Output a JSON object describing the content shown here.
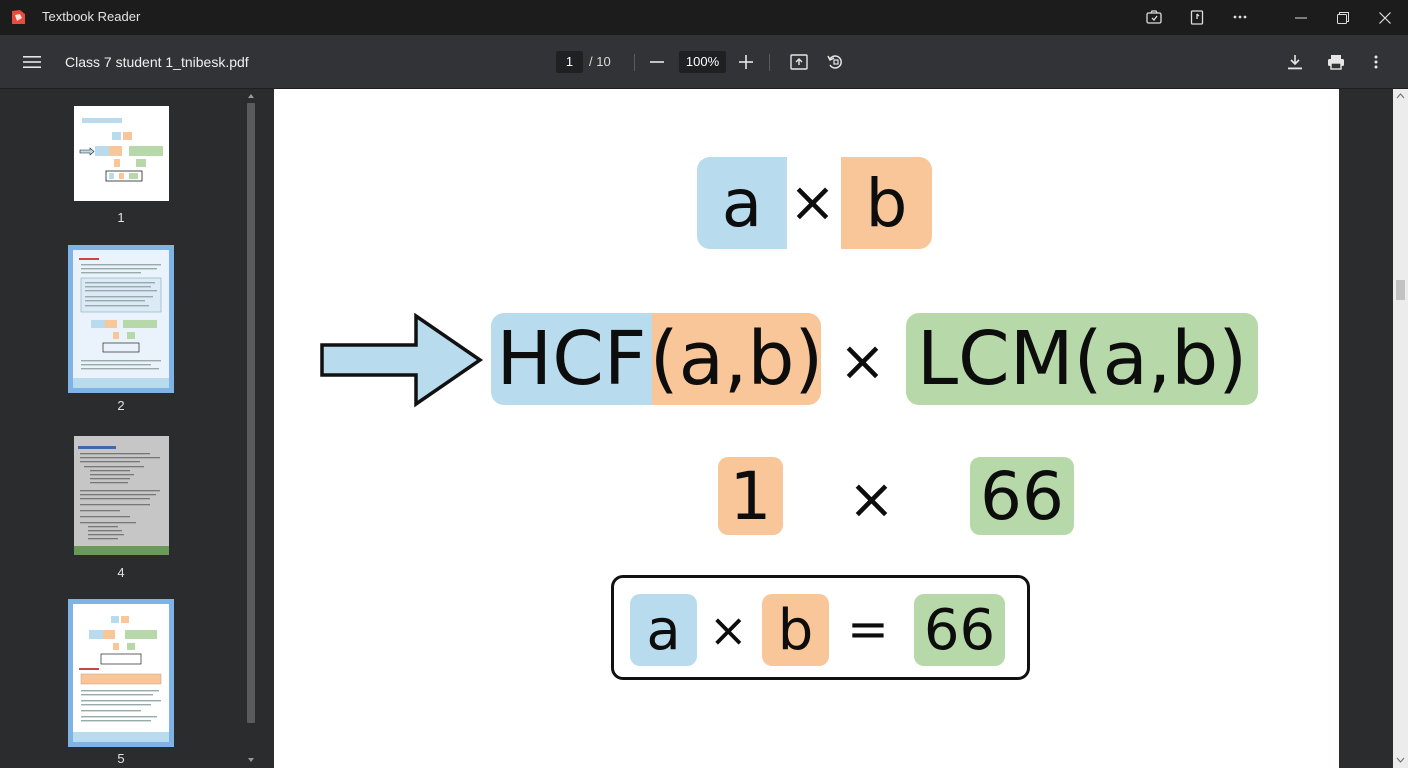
{
  "app": {
    "title": "Textbook Reader"
  },
  "titlebar": {
    "icons": [
      "screenshot-icon",
      "bookmark-icon",
      "more-icon",
      "minimize-icon",
      "restore-icon",
      "close-icon"
    ]
  },
  "toolbar": {
    "document_title": "Class 7 student 1_tnibesk.pdf",
    "current_page": "1",
    "total_pages": "/ 10",
    "zoom": "100%"
  },
  "sidebar": {
    "thumbnails": [
      {
        "label": "1",
        "selected": false
      },
      {
        "label": "2",
        "selected": true
      },
      {
        "label": "4",
        "selected": false
      },
      {
        "label": "5",
        "selected": true
      }
    ]
  },
  "content": {
    "row1": {
      "a": "a",
      "times": "×",
      "b": "b"
    },
    "row2": {
      "hcf": "HCF",
      "ab": "(a,b)",
      "times": "×",
      "lcm": "LCM(a,b)"
    },
    "row3": {
      "one": "1",
      "times": "×",
      "sixty_six": "66"
    },
    "row4": {
      "a": "a",
      "times": "×",
      "b": "b",
      "equals": "=",
      "sixty_six": "66"
    }
  },
  "colors": {
    "blue": "#b9dbee",
    "orange": "#f8c698",
    "green": "#b7d8a8",
    "selection": "#7fb3e5"
  }
}
